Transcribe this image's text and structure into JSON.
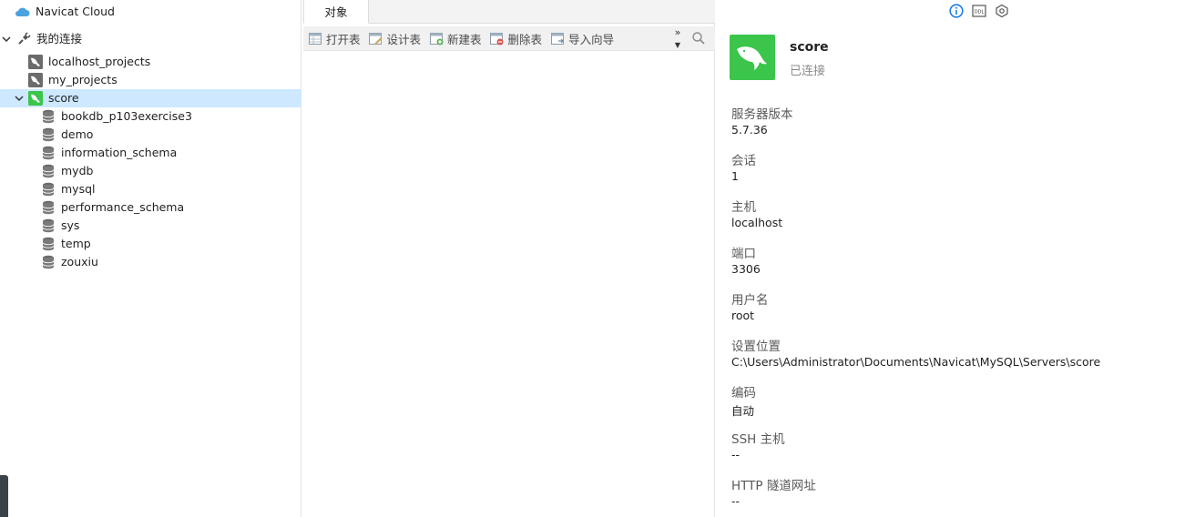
{
  "tree": {
    "cloud_label": "Navicat Cloud",
    "connections_label": "我的连接",
    "connections": [
      {
        "label": "localhost_projects"
      },
      {
        "label": "my_projects"
      },
      {
        "label": "score"
      }
    ],
    "databases": [
      {
        "label": "bookdb_p103exercise3"
      },
      {
        "label": "demo"
      },
      {
        "label": "information_schema"
      },
      {
        "label": "mydb"
      },
      {
        "label": "mysql"
      },
      {
        "label": "performance_schema"
      },
      {
        "label": "sys"
      },
      {
        "label": "temp"
      },
      {
        "label": "zouxiu"
      }
    ]
  },
  "center": {
    "tab_label": "对象",
    "toolbar": {
      "open_table": "打开表",
      "design_table": "设计表",
      "new_table": "新建表",
      "delete_table": "删除表",
      "import_wizard": "导入向导"
    }
  },
  "info": {
    "name": "score",
    "status": "已连接",
    "props": [
      {
        "label": "服务器版本",
        "value": "5.7.36"
      },
      {
        "label": "会话",
        "value": "1"
      },
      {
        "label": "主机",
        "value": "localhost"
      },
      {
        "label": "端口",
        "value": "3306"
      },
      {
        "label": "用户名",
        "value": "root"
      },
      {
        "label": "设置位置",
        "value": "C:\\Users\\Administrator\\Documents\\Navicat\\MySQL\\Servers\\score"
      },
      {
        "label": "编码",
        "value": "自动"
      },
      {
        "label": "SSH 主机",
        "value": "--"
      },
      {
        "label": "HTTP 隧道网址",
        "value": "--"
      }
    ]
  },
  "colors": {
    "selection": "#cde8ff",
    "mysql_green": "#3bc54a",
    "info_blue": "#1e7be6"
  }
}
